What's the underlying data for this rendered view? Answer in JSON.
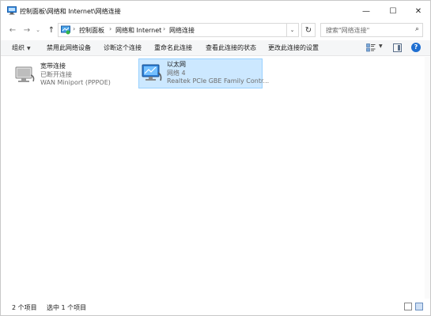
{
  "window": {
    "title": "控制面板\\网络和 Internet\\网络连接",
    "min_glyph": "—",
    "max_glyph": "☐",
    "close_glyph": "✕"
  },
  "address": {
    "back_glyph": "←",
    "forward_glyph": "→",
    "recent_glyph": "⌄",
    "up_glyph": "↑",
    "breadcrumbs": [
      "控制面板",
      "网络和 Internet",
      "网络连接"
    ],
    "separator": "›",
    "dropdown_glyph": "⌄",
    "refresh_glyph": "↻",
    "search_placeholder": "搜索\"网络连接\"",
    "search_glyph": "⌕"
  },
  "command_bar": {
    "organize": "组织",
    "organize_arrow": "▼",
    "disable": "禁用此网络设备",
    "diagnose": "诊断这个连接",
    "rename": "重命名此连接",
    "view_status": "查看此连接的状态",
    "change_settings": "更改此连接的设置",
    "view_drop": "▼",
    "help": "?"
  },
  "connections": [
    {
      "name": "宽带连接",
      "status": "已断开连接",
      "device": "WAN Miniport (PPPOE)",
      "selected": false
    },
    {
      "name": "以太网",
      "status": "网络 4",
      "device": "Realtek PCIe GBE Family Contr...",
      "selected": true
    }
  ],
  "status_bar": {
    "item_count": "2 个项目",
    "selected_count": "选中 1 个项目"
  },
  "colors": {
    "selection_bg": "#cce8ff",
    "selection_border": "#99d1ff",
    "help_blue": "#1f6fd1"
  }
}
